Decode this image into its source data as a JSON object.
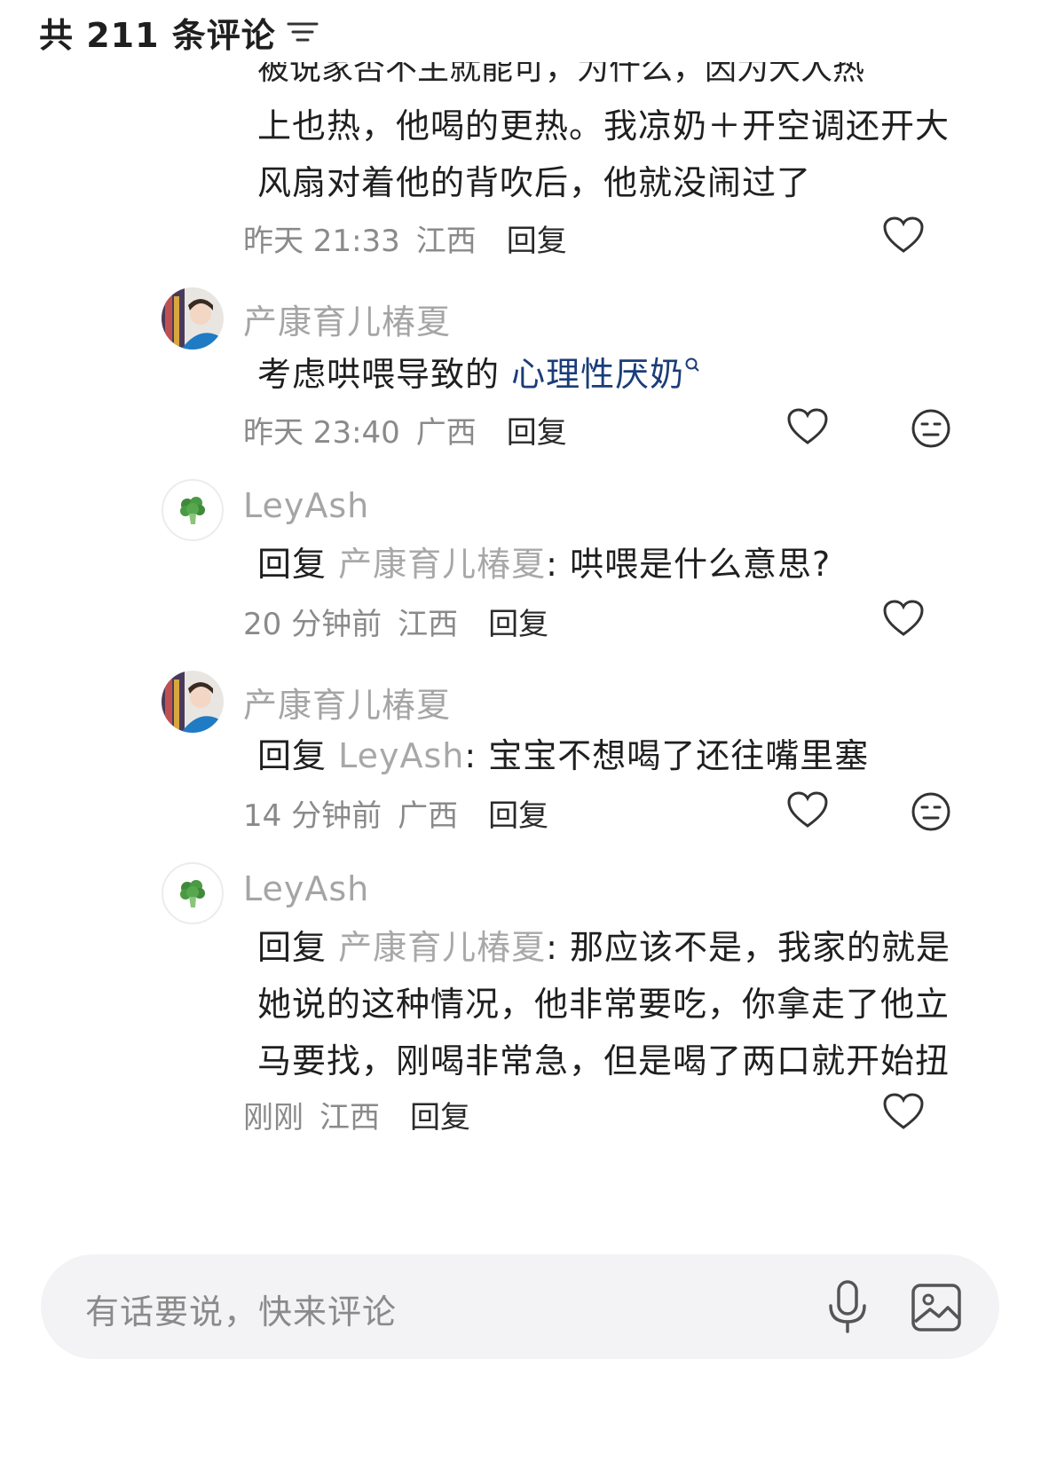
{
  "header": {
    "title": "共 211 条评论"
  },
  "top_comment": {
    "clipped_line": "被说家否不主就能可，为什么，因为大人热",
    "lines": [
      "上也热，他喝的更热。我凉奶＋开空调还开大",
      "风扇对着他的背吹后，他就没闹过了"
    ],
    "time": "昨天 21:33",
    "location": "江西",
    "reply_label": "回复"
  },
  "comments": [
    {
      "username": "产康育儿椿夏",
      "text_prefix": "考虑哄喂导致的",
      "link_text": "心理性厌奶",
      "time": "昨天 23:40",
      "location": "广西",
      "reply_label": "回复"
    },
    {
      "username": "LeyAsh",
      "reply_prefix": "回复",
      "mention": "产康育儿椿夏",
      "text": ": 哄喂是什么意思?",
      "time": "20 分钟前",
      "location": "江西",
      "reply_label": "回复"
    },
    {
      "username": "产康育儿椿夏",
      "reply_prefix": "回复",
      "mention": "LeyAsh",
      "text": ": 宝宝不想喝了还往嘴里塞",
      "time": "14 分钟前",
      "location": "广西",
      "reply_label": "回复"
    },
    {
      "username": "LeyAsh",
      "reply_prefix": "回复",
      "mention": "产康育儿椿夏",
      "text_line1": ": 那应该不是，我家的就是",
      "text_line2": "她说的这种情况，他非常要吃，你拿走了他立",
      "text_line3": "马要找，刚喝非常急，但是喝了两口就开始扭",
      "time": "刚刚",
      "location": "江西",
      "reply_label": "回复"
    }
  ],
  "input": {
    "placeholder": "有话要说，快来评论"
  },
  "colors": {
    "link": "#1a3d7a",
    "meta": "#8a8a8a",
    "mention": "#a8a8a8"
  }
}
